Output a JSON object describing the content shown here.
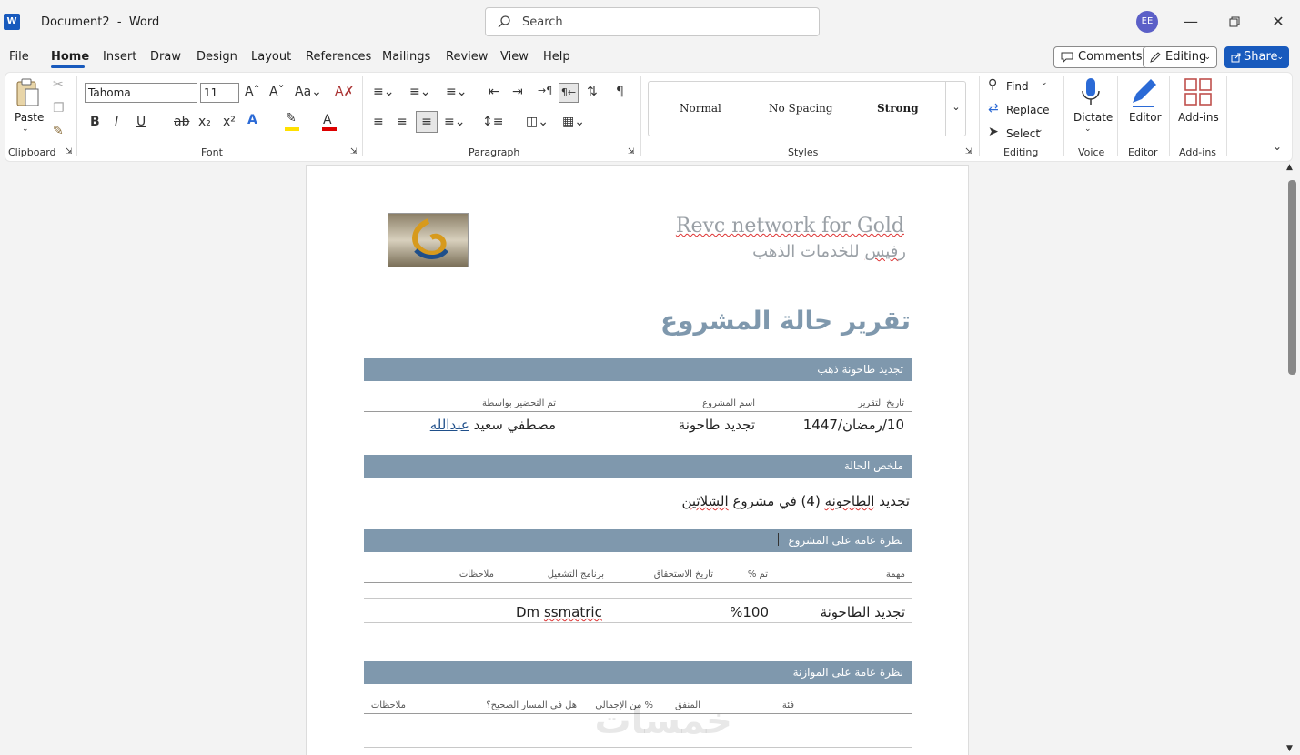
{
  "window": {
    "title": "Document2  -  Word",
    "app_icon": "W"
  },
  "search": {
    "placeholder": "Search"
  },
  "user": {
    "initials": "EE"
  },
  "menu": {
    "items": [
      "File",
      "Home",
      "Insert",
      "Draw",
      "Design",
      "Layout",
      "References",
      "Mailings",
      "Review",
      "View",
      "Help"
    ],
    "active": "Home"
  },
  "top_buttons": {
    "comments": "Comments",
    "editing": "Editing",
    "share": "Share"
  },
  "ribbon": {
    "clipboard": {
      "label": "Clipboard",
      "paste": "Paste"
    },
    "font": {
      "label": "Font",
      "family": "Tahoma",
      "size": "11"
    },
    "paragraph": {
      "label": "Paragraph"
    },
    "styles": {
      "label": "Styles",
      "items": [
        "Normal",
        "No Spacing",
        "Strong"
      ]
    },
    "editing": {
      "label": "Editing",
      "find": "Find",
      "replace": "Replace",
      "select": "Select"
    },
    "voice": {
      "label": "Voice",
      "dictate": "Dictate"
    },
    "editor": {
      "label": "Editor",
      "editor": "Editor"
    },
    "addins": {
      "label": "Add-ins",
      "addins": "Add-ins"
    }
  },
  "doc": {
    "company_en": "Revc network for Gold",
    "company_ar_pre": "ر",
    "company_ar_wavy": "فيس",
    "company_ar_post": " للخدمات الذهب",
    "title": "تقرير حالة المشروع",
    "band1": "تجديد طاحونة ذهب",
    "h_date": "تاريخ التقرير",
    "h_name": "اسم المشروع",
    "h_by": "تم التحضير بواسطة",
    "v_date": "10/رمضان/1447",
    "v_name": "تجديد طاحونة",
    "v_by_pre": "مصطفي سعيد ",
    "v_by_link": "عبدالله",
    "band2": "ملخص الحالة",
    "summary_pre": "تجديد ",
    "summary_wavy1": "الطاحونه",
    "summary_mid": " (4) في مشروع ",
    "summary_wavy2": "الشلاتين",
    "band3": "نظرة عامة على المشروع",
    "t_task": "مهمة",
    "t_done": "تم %",
    "t_due": "تاريخ الاستحقاق",
    "t_prog": "برنامج التشغيل",
    "t_notes": "ملاحظات",
    "r_task": "تجديد الطاحونة",
    "r_done": "%100",
    "r_prog_pre": "Dm ",
    "r_prog_wavy": "ssmatric",
    "band4": "نظرة عامة على الموازنة",
    "b_cat": "فئة",
    "b_spent": "المنفق",
    "b_pct": "% من الإجمالي",
    "b_ontrack": "هل في المسار الصحيح؟",
    "b_notes": "ملاحظات",
    "watermark": "خمسات"
  }
}
